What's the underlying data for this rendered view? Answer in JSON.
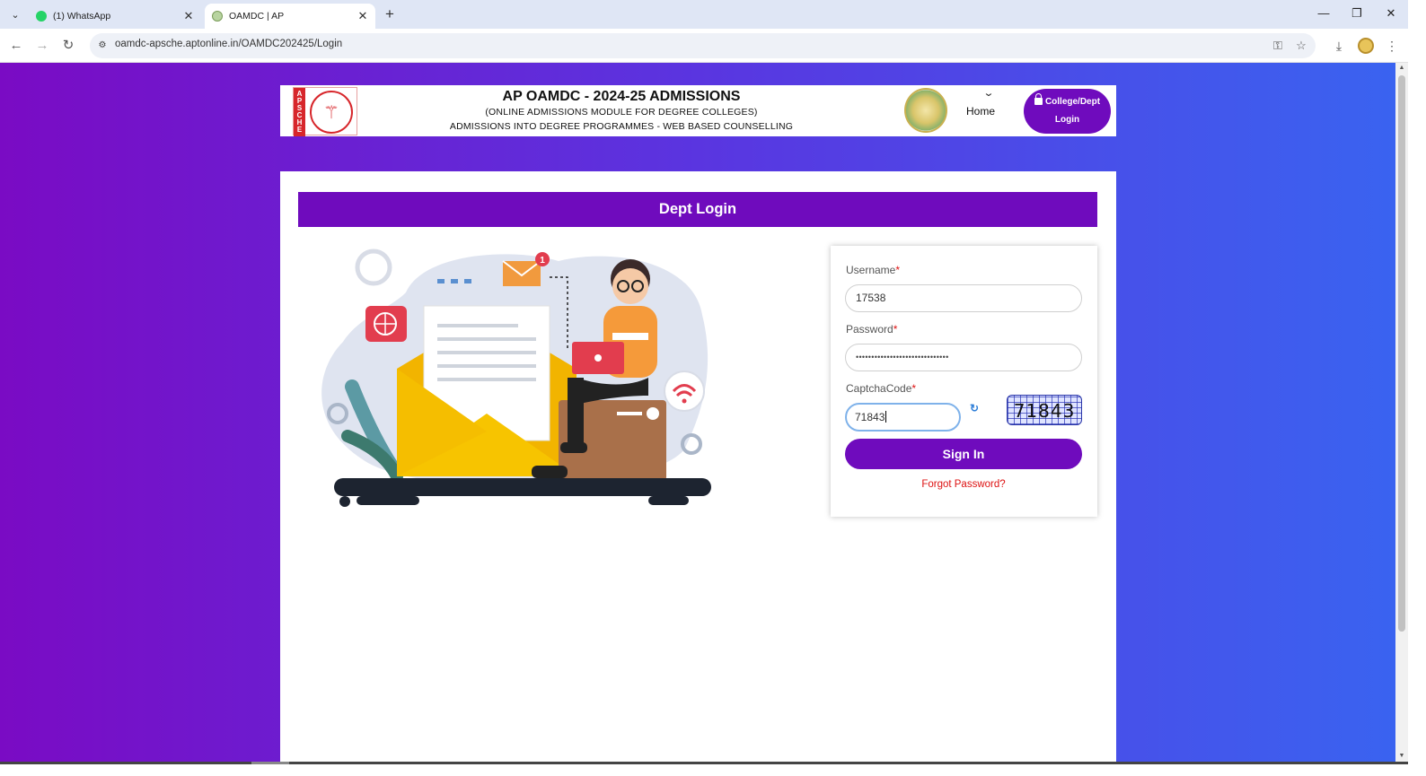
{
  "browser": {
    "tabs": [
      {
        "title": "(1) WhatsApp",
        "active": false,
        "favicon": "whatsapp-icon"
      },
      {
        "title": "OAMDC | AP",
        "active": true,
        "favicon": "site-icon"
      }
    ],
    "url": "oamdc-apsche.aptonline.in/OAMDC202425/Login"
  },
  "header": {
    "logo_left_text": "APSCHE",
    "title": "AP OAMDC - 2024-25 ADMISSIONS",
    "subtitle1": "(ONLINE ADMISSIONS MODULE FOR DEGREE COLLEGES)",
    "subtitle2": "ADMISSIONS INTO DEGREE PROGRAMMES - WEB BASED COUNSELLING",
    "nav": {
      "home": "Home",
      "login_line1": "College/Dept",
      "login_line2": "Login"
    }
  },
  "login": {
    "heading": "Dept Login",
    "username_label": "Username",
    "username_value": "17538",
    "password_label": "Password",
    "password_value": "••••••••••••••••••••••••••••••",
    "captcha_label": "CaptchaCode",
    "captcha_value": "71843",
    "captcha_image_text": "71843",
    "required_mark": "*",
    "signin_label": "Sign In",
    "forgot_label": "Forgot Password?"
  },
  "illustration": {
    "notification_count": "1"
  },
  "colors": {
    "primary_purple": "#6f0bbd",
    "gradient_left": "#7a0bc4",
    "gradient_right": "#3a63f0",
    "error_red": "#dd1111"
  }
}
